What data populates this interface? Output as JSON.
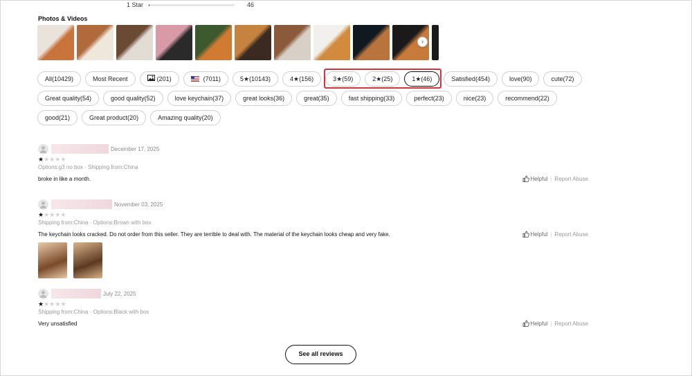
{
  "rating_bar": {
    "label": "1 Star",
    "count": "46",
    "fraction": 0.01
  },
  "photos_section_title": "Photos & Videos",
  "thumbnails": [
    {
      "name": "thumb-1",
      "c1": "#e9e3dc",
      "c2": "#c8743c"
    },
    {
      "name": "thumb-2",
      "c1": "#b06a3c",
      "c2": "#efe6dc"
    },
    {
      "name": "thumb-3",
      "c1": "#6b4a34",
      "c2": "#e2dcd4"
    },
    {
      "name": "thumb-4",
      "c1": "#d79aa6",
      "c2": "#2a2a2a"
    },
    {
      "name": "thumb-5",
      "c1": "#3d5a2f",
      "c2": "#d07a32"
    },
    {
      "name": "thumb-6",
      "c1": "#c6823f",
      "c2": "#3a2a22"
    },
    {
      "name": "thumb-7",
      "c1": "#8b5a3a",
      "c2": "#d8d0c6"
    },
    {
      "name": "thumb-8",
      "c1": "#f2f0ec",
      "c2": "#d28a3e"
    },
    {
      "name": "thumb-9",
      "c1": "#101820",
      "c2": "#b8743c"
    },
    {
      "name": "thumb-10",
      "c1": "#1a1a1a",
      "c2": "#c77a3a"
    }
  ],
  "chip_rows": [
    [
      {
        "label": "All(10429)",
        "active": false
      },
      {
        "label": "Most Recent",
        "active": false
      },
      {
        "label": "(201)",
        "icon": "image-icon",
        "active": false
      },
      {
        "label": "(7011)",
        "icon": "us-flag-icon",
        "active": false
      },
      {
        "label": "5★(10143)",
        "active": false
      },
      {
        "label": "4★(156)",
        "active": false
      },
      {
        "label": "3★(59)",
        "active": false
      },
      {
        "label": "2★(25)",
        "active": false
      },
      {
        "label": "1★(46)",
        "active": true
      },
      {
        "label": "Satisfied(454)",
        "active": false
      },
      {
        "label": "love(90)",
        "active": false
      },
      {
        "label": "cute(72)",
        "active": false
      }
    ],
    [
      {
        "label": "Great quality(54)",
        "active": false
      },
      {
        "label": "good quality(52)",
        "active": false
      },
      {
        "label": "love keychain(37)",
        "active": false
      },
      {
        "label": "great looks(36)",
        "active": false
      },
      {
        "label": "great(35)",
        "active": false
      },
      {
        "label": "fast shipping(33)",
        "active": false
      },
      {
        "label": "perfect(23)",
        "active": false
      },
      {
        "label": "nice(23)",
        "active": false
      },
      {
        "label": "recommend(22)",
        "active": false
      }
    ],
    [
      {
        "label": "good(21)",
        "active": false
      },
      {
        "label": "Great product(20)",
        "active": false
      },
      {
        "label": "Amazing quality(20)",
        "active": false
      }
    ]
  ],
  "reviews": [
    {
      "date": "December 17, 2025",
      "rating": 1,
      "meta": "Options:g3 no box · Shipping from:China",
      "text": "broke in like a month.",
      "helpful": "Helpful",
      "report": "Report Abuse",
      "photos": []
    },
    {
      "date": "November 03, 2025",
      "rating": 1,
      "meta": "Shipping from:China · Options:Brown with box",
      "text": "The keychain looks cracked. Do not order from this seller. They are terrible to deal with. The material of the keychain looks cheap and very fake.",
      "helpful": "Helpful",
      "report": "Report Abuse",
      "photos": [
        {
          "c1": "#e8c9a8",
          "c2": "#7a4a2a"
        },
        {
          "c1": "#d9b38a",
          "c2": "#5c3a22"
        }
      ]
    },
    {
      "date": "July 22, 2025",
      "rating": 1,
      "meta": "Shipping from:China · Options:Black with box",
      "text": "Very unsatisfied",
      "helpful": "Helpful",
      "report": "Report Abuse",
      "photos": []
    }
  ],
  "see_all_label": "See all reviews",
  "highlight_color": "#d1343c"
}
